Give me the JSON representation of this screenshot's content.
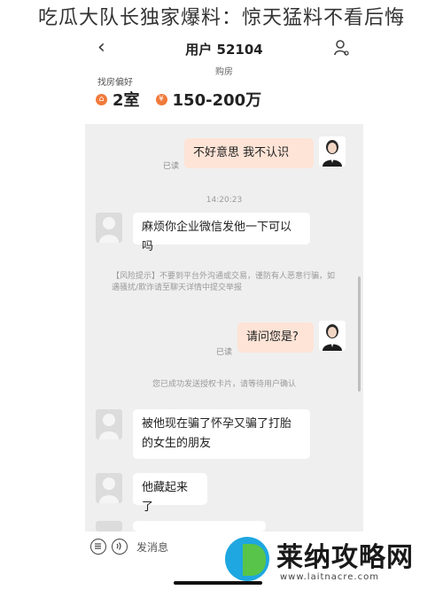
{
  "headline": "吃瓜大队长独家爆料：惊天猛料不看后悔",
  "nav": {
    "back_glyph": "‹",
    "title": "用户 52104"
  },
  "subtitle": "购房",
  "preferences": {
    "label": "找房偏好",
    "rooms": "2室",
    "price": "150-200万",
    "accent_color": "#f07a3a"
  },
  "chat": {
    "messages": [
      {
        "from": "me",
        "text": "不好意思  我不认识",
        "status": "已读"
      },
      {
        "type": "time",
        "text": "14:20:23"
      },
      {
        "from": "them",
        "text": "麻烦你企业微信发他一下可以吗"
      },
      {
        "type": "system",
        "text": "【风险提示】不要到平台外沟通或交易，谨防有人恶意行骗，如遇骚扰/欺诈请至聊天详情中提交举报"
      },
      {
        "from": "me",
        "text": "请问您是?",
        "status": "已读"
      },
      {
        "type": "system",
        "text": "您已成功发送授权卡片，请等待用户确认"
      },
      {
        "from": "them",
        "text": "被他现在骗了怀孕又骗了打胎的女生的朋友"
      },
      {
        "from": "them",
        "text": "他藏起来了"
      }
    ]
  },
  "input": {
    "placeholder": "发消息"
  },
  "watermark": {
    "name": "莱纳攻略网",
    "url": "www.laitnacre.com"
  },
  "colors": {
    "my_bubble": "#fde4d6",
    "their_bubble": "#ffffff",
    "chat_bg": "#efefef"
  }
}
